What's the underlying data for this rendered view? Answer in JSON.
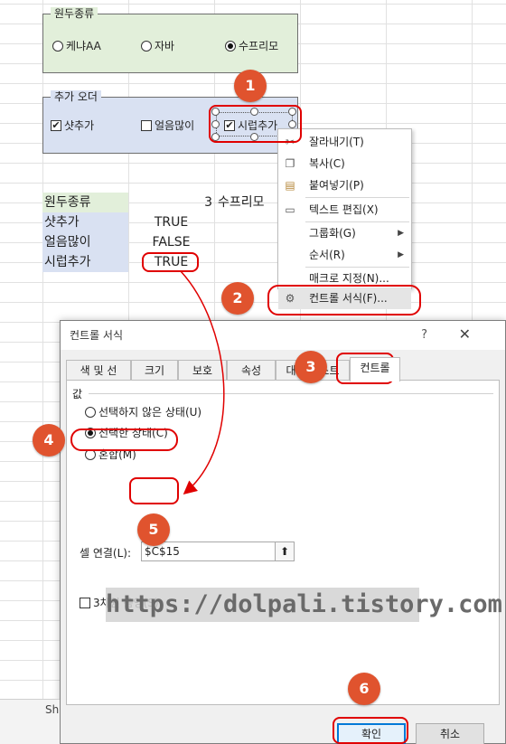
{
  "groupbox_bean": {
    "title": "원두종류",
    "options": [
      {
        "label": "케냐AA",
        "selected": false
      },
      {
        "label": "자바",
        "selected": false
      },
      {
        "label": "수프리모",
        "selected": true
      }
    ]
  },
  "groupbox_addorder": {
    "title": "추가 오더",
    "options": [
      {
        "label": "샷추가",
        "checked": true
      },
      {
        "label": "얼음많이",
        "checked": false
      },
      {
        "label": "시럽추가",
        "checked": true
      }
    ],
    "check_glyph": "✔"
  },
  "sheet": {
    "rows": [
      {
        "label": "원두종류",
        "value": "3",
        "extra": "수프리모"
      },
      {
        "label": "샷추가",
        "value": "TRUE"
      },
      {
        "label": "얼음많이",
        "value": "FALSE"
      },
      {
        "label": "시럽추가",
        "value": "TRUE"
      }
    ],
    "tab_label": "Sh"
  },
  "context_menu": {
    "items": [
      {
        "label": "잘라내기(T)",
        "icon": "scissors-icon",
        "disabled": false
      },
      {
        "label": "복사(C)",
        "icon": "copy-icon",
        "disabled": false
      },
      {
        "label": "붙여넣기(P)",
        "icon": "paste-icon",
        "disabled": false
      },
      {
        "label": "텍스트 편집(X)",
        "icon": "text-edit-icon",
        "disabled": false
      },
      {
        "label": "그룹화(G)",
        "submenu": true
      },
      {
        "label": "순서(R)",
        "submenu": true
      },
      {
        "label": "매크로 지정(N)...",
        "disabled": false
      },
      {
        "label": "컨트롤 서식(F)...",
        "icon": "format-control-icon",
        "highlighted": true
      }
    ],
    "submenu_arrow": "▶"
  },
  "dialog": {
    "title": "컨트롤 서식",
    "help": "?",
    "close": "✕",
    "tabs": [
      "색 및 선",
      "크기",
      "보호",
      "속성",
      "대체 텍스트",
      "컨트롤"
    ],
    "active_tab": "컨트롤",
    "value_section": "값",
    "radio_options": [
      {
        "label": "선택하지 않은 상태(U)",
        "selected": false
      },
      {
        "label": "선택한 상태(C)",
        "selected": true
      },
      {
        "label": "혼합(M)",
        "selected": false
      }
    ],
    "cell_link_label": "셀 연결(L):",
    "cell_link_value": "$C$15",
    "collapse_icon": "⬆",
    "shading_label": "3차원 음영(S)",
    "shading_checked": false,
    "ok_label": "확인",
    "cancel_label": "취소"
  },
  "annotations": {
    "markers": [
      "1",
      "2",
      "3",
      "4",
      "5",
      "6"
    ],
    "color": "#e0532e",
    "ring_color": "#e00000"
  },
  "watermark": "https://dolpali.tistory.com",
  "colors": {
    "green_fill": "#e2efda",
    "blue_fill": "#d9e1f2",
    "accent": "#0078d7"
  }
}
